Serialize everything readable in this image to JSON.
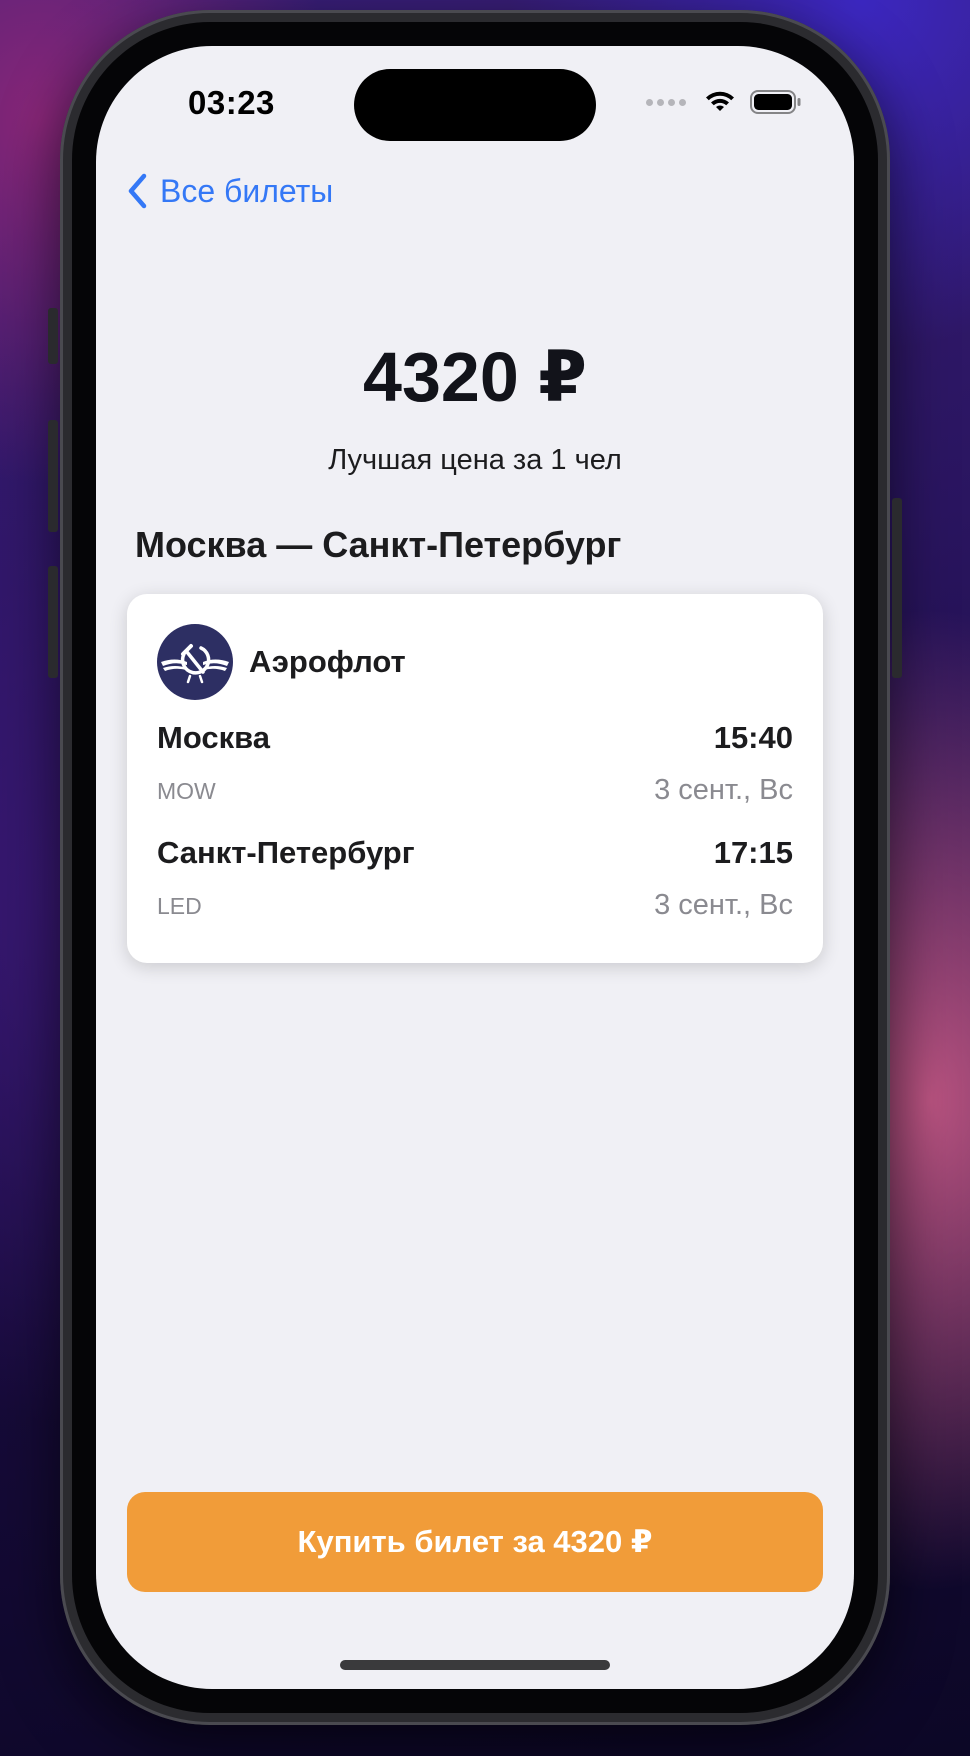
{
  "status_bar": {
    "time": "03:23",
    "icons": [
      "signal-dots-icon",
      "wifi-icon",
      "battery-icon"
    ]
  },
  "nav": {
    "back_label": "Все билеты",
    "back_icon": "chevron-left-icon"
  },
  "header": {
    "price": "4320 ₽",
    "price_caption": "Лучшая цена за 1 чел"
  },
  "route": {
    "title": "Москва — Санкт-Петербург"
  },
  "ticket": {
    "airline": "Аэрофлот",
    "airline_logo": "aeroflot-logo-icon",
    "departure": {
      "city": "Москва",
      "time": "15:40",
      "code": "MOW",
      "date": "3 сент., Вс"
    },
    "arrival": {
      "city": "Санкт-Петербург",
      "time": "17:15",
      "code": "LED",
      "date": "3 сент., Вс"
    }
  },
  "buy_button": {
    "label": "Купить билет за 4320 ₽"
  },
  "colors": {
    "accent": "#3478f6",
    "buy_button": "#f19c39",
    "screen_background": "#f0f0f5",
    "card_background": "#ffffff",
    "secondary_text": "#8a8a90",
    "airline_logo_bg": "#2d2f63"
  }
}
